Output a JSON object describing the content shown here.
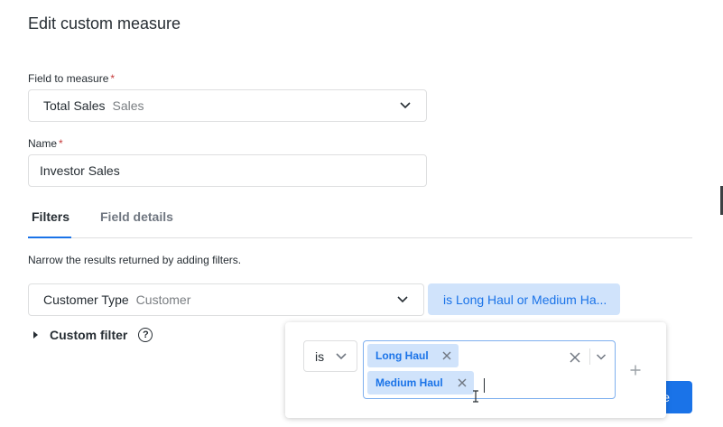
{
  "dialog": {
    "title": "Edit custom measure"
  },
  "field_to_measure": {
    "label": "Field to measure",
    "required_mark": "*",
    "value_main": "Total Sales",
    "value_sub": "Sales"
  },
  "name": {
    "label": "Name",
    "required_mark": "*",
    "value": "Investor Sales"
  },
  "tabs": [
    {
      "label": "Filters",
      "active": true
    },
    {
      "label": "Field details",
      "active": false
    }
  ],
  "filters": {
    "helper_text": "Narrow the results returned by adding filters.",
    "filter_field_main": "Customer Type",
    "filter_field_sub": "Customer",
    "filter_summary": "is Long Haul or Medium Ha...",
    "custom_filter_label": "Custom filter",
    "help_symbol": "?"
  },
  "popover": {
    "operator": "is",
    "selected_values": [
      "Long Haul",
      "Medium Haul"
    ]
  },
  "footer": {
    "button_label": "e"
  },
  "icons": {
    "dropdown": "chevron-down-icon",
    "remove": "close-icon",
    "add": "plus-icon",
    "help": "help-circle-icon",
    "expand": "caret-right-icon",
    "cursor": "text-cursor-icon"
  },
  "colors": {
    "accent": "#1a73e8",
    "chip_bg": "#d0e3fb",
    "border": "#dedfe0",
    "required": "#c63b3b"
  }
}
